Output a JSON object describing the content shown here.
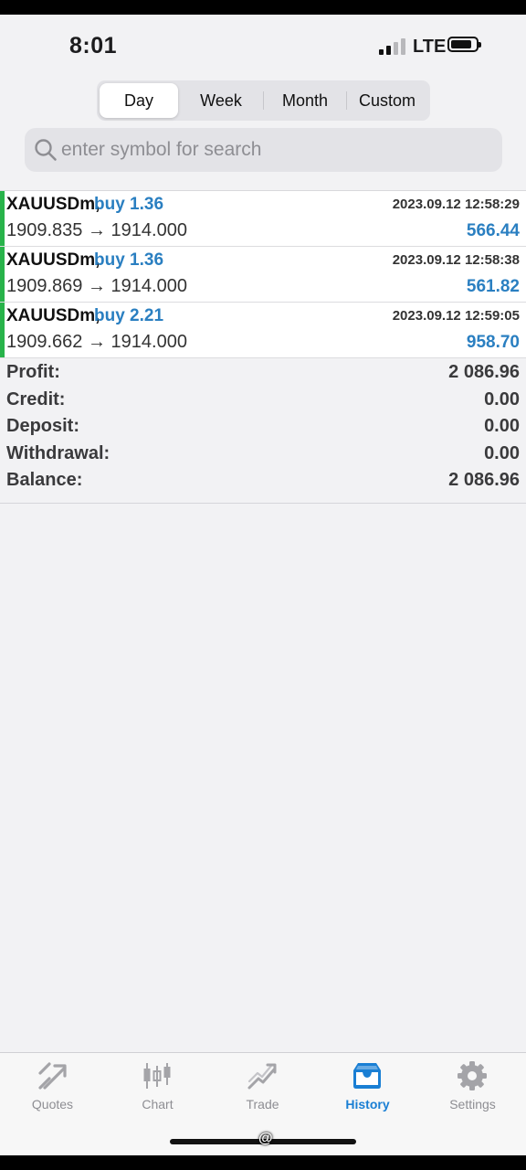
{
  "status_bar": {
    "time": "8:01",
    "network": "LTE"
  },
  "period_tabs": [
    {
      "label": "Day",
      "active": true
    },
    {
      "label": "Week",
      "active": false
    },
    {
      "label": "Month",
      "active": false
    },
    {
      "label": "Custom",
      "active": false
    }
  ],
  "search": {
    "placeholder": "enter symbol for search",
    "icon": "search-icon"
  },
  "deals": [
    {
      "symbol": "XAUUSDm,",
      "type": "buy 1.36",
      "time": "2023.09.12 12:58:29",
      "prices": "1909.835 → 1914.000",
      "profit": "566.44"
    },
    {
      "symbol": "XAUUSDm,",
      "type": "buy 1.36",
      "time": "2023.09.12 12:58:38",
      "prices": "1909.869 → 1914.000",
      "profit": "561.82"
    },
    {
      "symbol": "XAUUSDm,",
      "type": "buy 2.21",
      "time": "2023.09.12 12:59:05",
      "prices": "1909.662 → 1914.000",
      "profit": "958.70"
    }
  ],
  "summary": [
    {
      "label": "Profit:",
      "value": "2 086.96"
    },
    {
      "label": "Credit:",
      "value": "0.00"
    },
    {
      "label": "Deposit:",
      "value": "0.00"
    },
    {
      "label": "Withdrawal:",
      "value": "0.00"
    },
    {
      "label": "Balance:",
      "value": "2 086.96"
    }
  ],
  "tab_bar": [
    {
      "label": "Quotes",
      "icon": "quotes-icon",
      "active": false
    },
    {
      "label": "Chart",
      "icon": "chart-icon",
      "active": false
    },
    {
      "label": "Trade",
      "icon": "trade-icon",
      "active": false
    },
    {
      "label": "History",
      "icon": "history-icon",
      "active": true
    },
    {
      "label": "Settings",
      "icon": "settings-icon",
      "active": false
    }
  ],
  "colors": {
    "accent": "#1a7fd4",
    "buy_text": "#2a7fc1",
    "deal_marker": "#28b34a",
    "background": "#f2f2f4"
  },
  "watermark": "@"
}
